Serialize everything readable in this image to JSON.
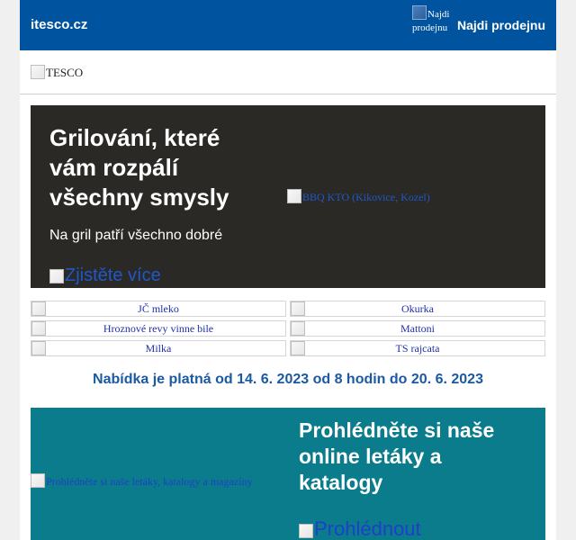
{
  "colors": {
    "header_bg": "#00539f",
    "hero_bg": "#2a2926",
    "leaflet_bg": "#0b7c8c",
    "validity_text": "#1a5aa3"
  },
  "header": {
    "site_link": "itesco.cz",
    "store_image_alt": "Najdi prodejnu",
    "store_link": "Najdi prodejnu"
  },
  "logo": {
    "alt": "TESCO"
  },
  "hero": {
    "title": "Grilování, které vám rozpálí všechny smysly",
    "subtitle": "Na gril patří všechno dobré",
    "cta_alt": "Zjistěte více",
    "image_alt": "BBQ KTO (Kikovice, Kozel)"
  },
  "products": [
    {
      "alt": "JČ mleko"
    },
    {
      "alt": "Okurka"
    },
    {
      "alt": "Hroznové revy vinne bile"
    },
    {
      "alt": "Mattoni"
    },
    {
      "alt": "Milka"
    },
    {
      "alt": "TS rajcata"
    }
  ],
  "validity": "Nabídka je platná od 14. 6. 2023 od 8 hodin do 20. 6. 2023",
  "leaflet": {
    "image_alt": "Prohlédněte si naše letáky, katalogy a magazíny",
    "title": "Prohlédněte si naše online letáky a katalogy",
    "cta_alt": "Prohlédnout"
  }
}
